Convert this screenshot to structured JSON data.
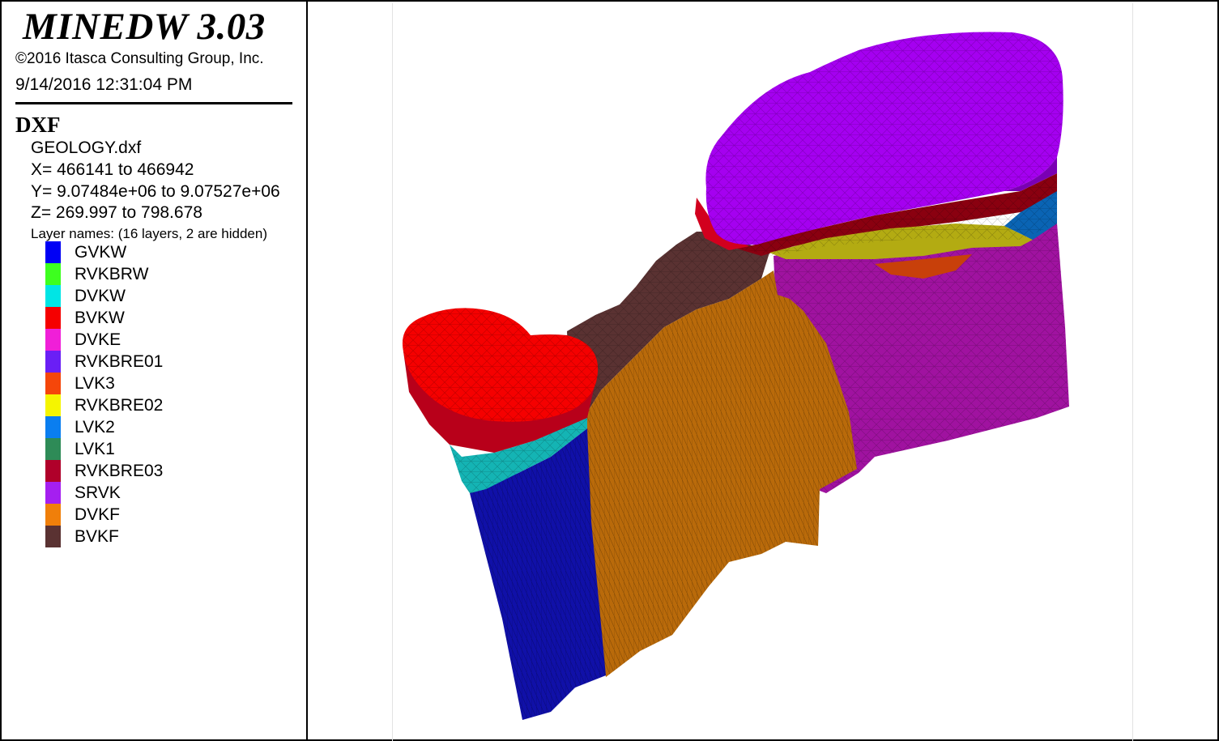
{
  "header": {
    "app_title": "MINEDW 3.03",
    "copyright": "©2016 Itasca Consulting Group, Inc.",
    "timestamp": "9/14/2016 12:31:04 PM"
  },
  "dxf": {
    "section_title": "DXF",
    "filename": "GEOLOGY.dxf",
    "x_range": "X= 466141 to 466942",
    "y_range": "Y= 9.07484e+06 to 9.07527e+06",
    "z_range": "Z= 269.997 to 798.678",
    "layer_note": "Layer names: (16 layers, 2 are hidden)",
    "layers": [
      {
        "name": "GVKW",
        "color": "#0000f5"
      },
      {
        "name": "RVKBRW",
        "color": "#3dff1f"
      },
      {
        "name": "DVKW",
        "color": "#00e5e5"
      },
      {
        "name": "BVKW",
        "color": "#f50000"
      },
      {
        "name": "DVKE",
        "color": "#f01fd8"
      },
      {
        "name": "RVKBRE01",
        "color": "#6a1ff5"
      },
      {
        "name": "LVK3",
        "color": "#f5460a"
      },
      {
        "name": "RVKBRE02",
        "color": "#f5f500"
      },
      {
        "name": "LVK2",
        "color": "#0a7ef0"
      },
      {
        "name": "LVK1",
        "color": "#2e8b57"
      },
      {
        "name": "RVKBRE03",
        "color": "#b0002a"
      },
      {
        "name": "SRVK",
        "color": "#a51ff0"
      },
      {
        "name": "DVKF",
        "color": "#f07f0a"
      },
      {
        "name": "BVKF",
        "color": "#5a3232"
      }
    ]
  }
}
